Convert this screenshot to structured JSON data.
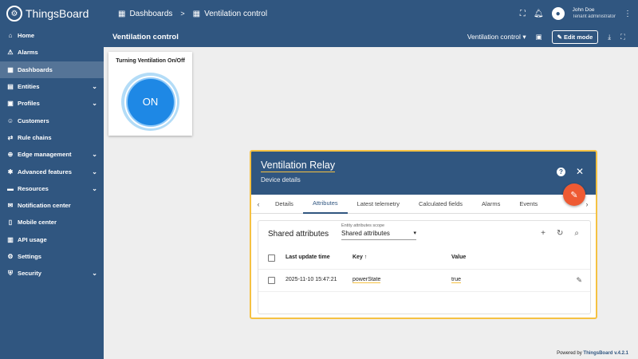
{
  "app": {
    "name": "ThingsBoard"
  },
  "sidebar": {
    "items": [
      {
        "label": "Home",
        "icon": "home-icon",
        "glyph": "⌂",
        "expandable": false
      },
      {
        "label": "Alarms",
        "icon": "alarm-icon",
        "glyph": "⚠",
        "expandable": false
      },
      {
        "label": "Dashboards",
        "icon": "dashboard-icon",
        "glyph": "▦",
        "expandable": false,
        "active": true
      },
      {
        "label": "Entities",
        "icon": "entities-icon",
        "glyph": "▤",
        "expandable": true
      },
      {
        "label": "Profiles",
        "icon": "profiles-icon",
        "glyph": "▣",
        "expandable": true
      },
      {
        "label": "Customers",
        "icon": "customers-icon",
        "glyph": "☺",
        "expandable": false
      },
      {
        "label": "Rule chains",
        "icon": "rule-chains-icon",
        "glyph": "⇄",
        "expandable": false
      },
      {
        "label": "Edge management",
        "icon": "edge-icon",
        "glyph": "⊕",
        "expandable": true
      },
      {
        "label": "Advanced features",
        "icon": "advanced-icon",
        "glyph": "✱",
        "expandable": true
      },
      {
        "label": "Resources",
        "icon": "folder-icon",
        "glyph": "▬",
        "expandable": true
      },
      {
        "label": "Notification center",
        "icon": "notification-icon",
        "glyph": "✉",
        "expandable": false
      },
      {
        "label": "Mobile center",
        "icon": "mobile-icon",
        "glyph": "▯",
        "expandable": false
      },
      {
        "label": "API usage",
        "icon": "api-usage-icon",
        "glyph": "▥",
        "expandable": false
      },
      {
        "label": "Settings",
        "icon": "settings-icon",
        "glyph": "⚙",
        "expandable": false
      },
      {
        "label": "Security",
        "icon": "security-icon",
        "glyph": "⛨",
        "expandable": true
      }
    ]
  },
  "topbar": {
    "crumb1": "Dashboards",
    "separator": ">",
    "crumb2": "Ventilation control",
    "user_name": "John Doe",
    "user_role": "Tenant administrator"
  },
  "dashboard": {
    "title": "Ventilation control",
    "state_select": "Ventilation control",
    "edit_label": "Edit mode"
  },
  "widget": {
    "title": "Turning Ventilation On/Off",
    "button_label": "ON"
  },
  "dialog": {
    "title": "Ventilation Relay",
    "subtitle": "Device details",
    "tabs": [
      "Details",
      "Attributes",
      "Latest telemetry",
      "Calculated fields",
      "Alarms",
      "Events"
    ],
    "active_tab": "Attributes",
    "panel_title": "Shared attributes",
    "scope_label": "Entity attributes scope",
    "scope_value": "Shared attributes",
    "columns": {
      "last_update": "Last update time",
      "key": "Key",
      "value": "Value"
    },
    "rows": [
      {
        "last_update": "2025-11-10 15:47:21",
        "key": "powerState",
        "value": "true"
      }
    ]
  },
  "footer": {
    "prefix": "Powered by",
    "brand": "ThingsBoard v.4.2.1"
  },
  "colors": {
    "primary": "#305680",
    "accent": "#ee5a33",
    "highlight": "#f5c142",
    "button": "#1e88e5"
  }
}
